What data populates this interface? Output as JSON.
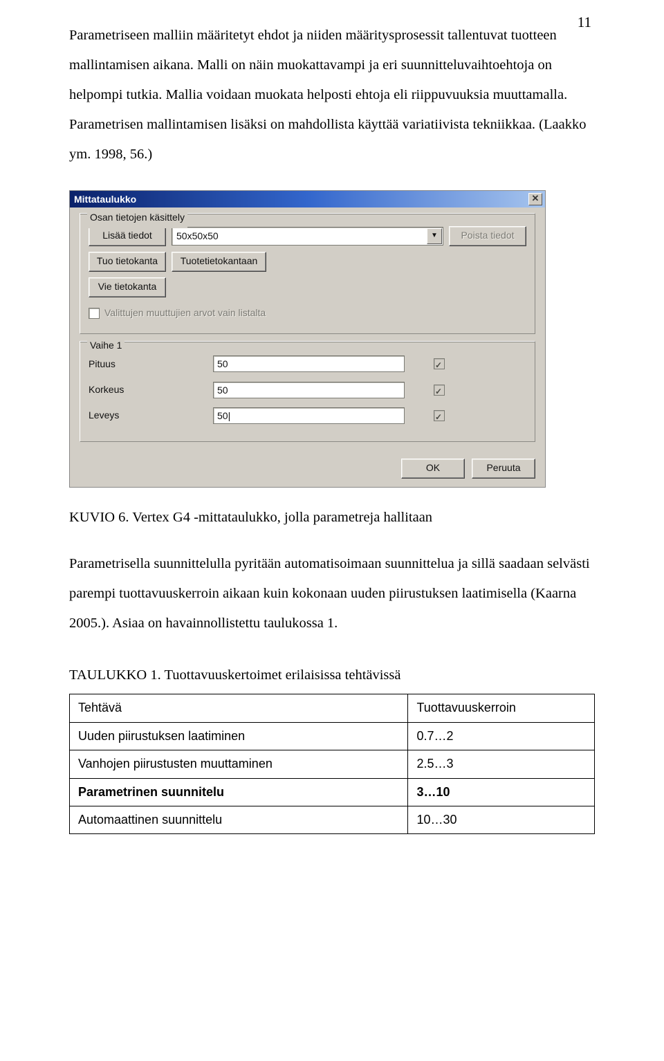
{
  "page_number": "11",
  "para1": "Parametriseen malliin määritetyt ehdot ja niiden määritysprosessit tallentuvat tuotteen mallintamisen aikana. Malli on näin muokattavampi ja eri suunnitteluvaihtoehtoja on helpompi tutkia. Mallia voidaan muokata helposti ehtoja eli riippuvuuksia muuttamalla. Parametrisen mallintamisen lisäksi on mahdollista käyttää variatiivista tekniikkaa. (Laakko ym. 1998, 56.)",
  "caption_fig": "KUVIO 6. Vertex G4 -mittataulukko, jolla parametreja hallitaan",
  "para2": "Parametrisella suunnittelulla pyritään automatisoimaan suunnittelua ja sillä saadaan selvästi parempi tuottavuuskerroin aikaan kuin kokonaan uuden piirustuksen laatimisella (Kaarna 2005.). Asiaa on havainnollistettu taulukossa 1.",
  "table_heading": "TAULUKKO 1. Tuottavuuskertoimet erilaisissa tehtävissä",
  "dialog": {
    "title": "Mittataulukko",
    "group1_legend": "Osan tietojen käsittely",
    "add_button": "Lisää tiedot",
    "combo_value": "50x50x50",
    "delete_button": "Poista tiedot",
    "import_db_button": "Tuo tietokanta",
    "product_db_button": "Tuotetietokantaan",
    "export_db_button": "Vie tietokanta",
    "checkbox_label": "Valittujen muuttujien arvot vain listalta",
    "group2_legend": "Vaihe 1",
    "field1_label": "Pituus",
    "field1_value": "50",
    "field2_label": "Korkeus",
    "field2_value": "50",
    "field3_label": "Leveys",
    "field3_value": "50|",
    "ok_button": "OK",
    "cancel_button": "Peruuta"
  },
  "table": {
    "header1": "Tehtävä",
    "header2": "Tuottavuuskerroin",
    "rows": [
      {
        "label": "Uuden piirustuksen laatiminen",
        "value": "0.7…2",
        "bold": false
      },
      {
        "label": "Vanhojen piirustusten muuttaminen",
        "value": "2.5…3",
        "bold": false
      },
      {
        "label": "Parametrinen suunnitelu",
        "value": "3…10",
        "bold": true
      },
      {
        "label": "Automaattinen suunnittelu",
        "value": "10…30",
        "bold": false
      }
    ]
  }
}
